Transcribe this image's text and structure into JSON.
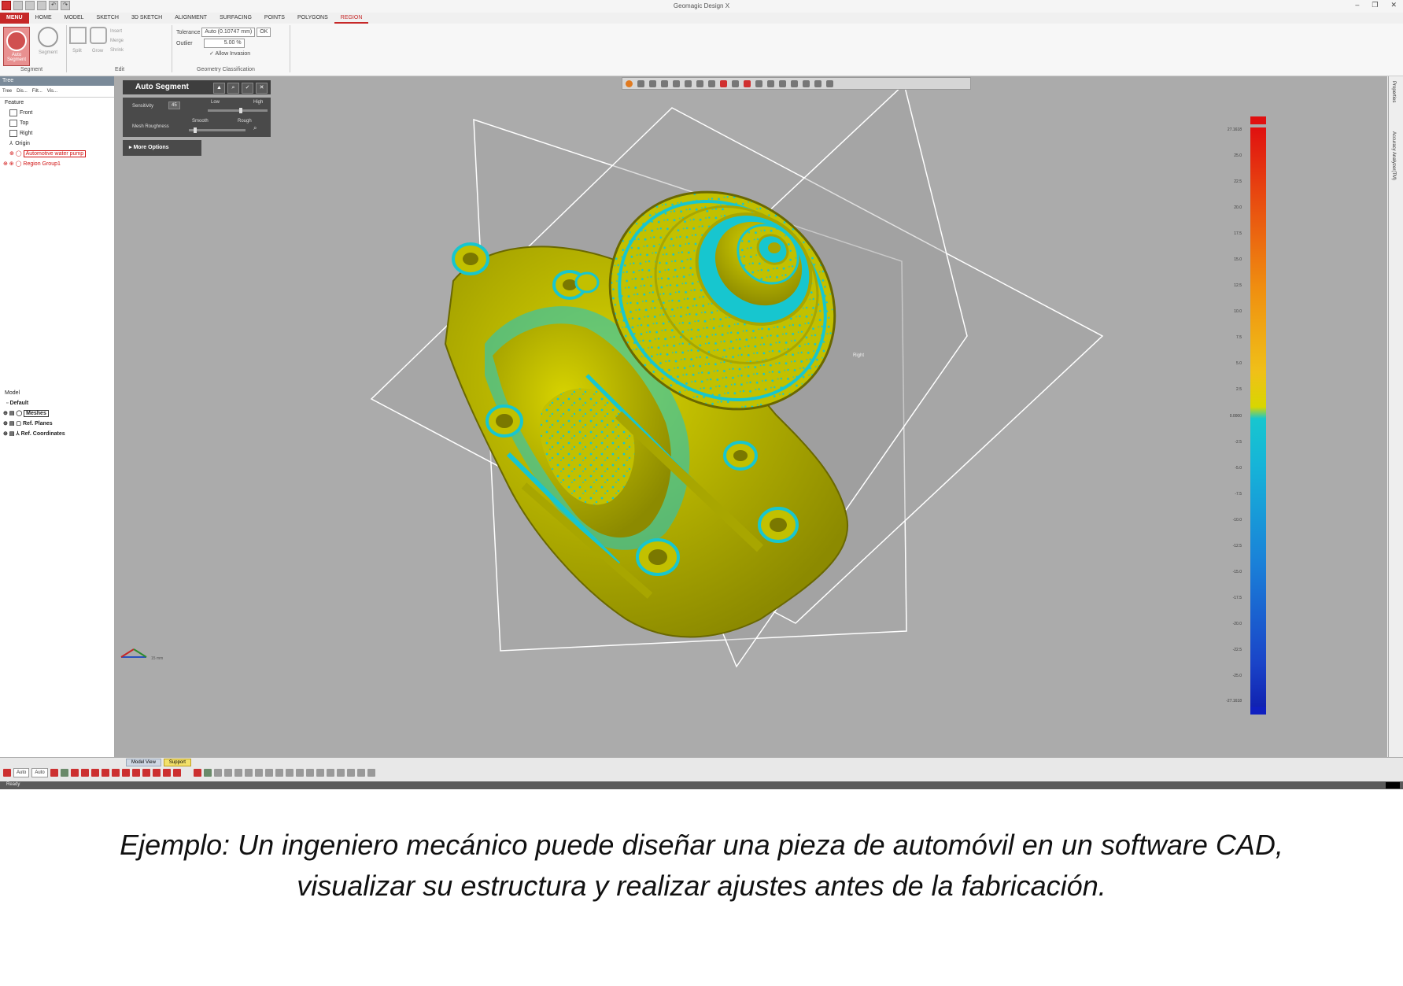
{
  "window": {
    "title": "Geomagic Design X",
    "controls": [
      "–",
      "❐",
      "✕"
    ]
  },
  "ribbon": {
    "tabs": [
      "MENU",
      "HOME",
      "MODEL",
      "SKETCH",
      "3D SKETCH",
      "ALIGNMENT",
      "SURFACING",
      "POINTS",
      "POLYGONS",
      "REGION"
    ],
    "active_tab": "REGION",
    "auto_segment_label": "Auto Segment",
    "segment_items": [
      "Segment",
      "Split",
      "Grow"
    ],
    "edit_items": [
      "Insert",
      "Merge",
      "Shrink"
    ],
    "tolerance_label": "Tolerance",
    "tolerance_value": "Auto (0.10747 mm)",
    "ok_label": "OK",
    "outlier_label": "Outlier",
    "outlier_value": "5.00 %",
    "allow_invasion_label": "Allow Invasion",
    "group_segment": "Segment",
    "group_edit": "Edit",
    "group_geometry": "Geometry Classification"
  },
  "left_panel": {
    "header": "Tree",
    "tools": [
      "Tree",
      "Dis...",
      "Filt...",
      "Vis..."
    ],
    "feature_label": "Feature",
    "feature_items": [
      "Front",
      "Top",
      "Right",
      "Origin",
      "Automotive water pump",
      "Region Group1"
    ],
    "model_label": "Model",
    "model_items": [
      "Default",
      "Meshes",
      "Ref. Planes",
      "Ref. Coordinates"
    ]
  },
  "auto_segment_panel": {
    "title": "Auto Segment",
    "sensitivity_label": "Sensitivity",
    "sensitivity_value": "45",
    "low_label": "Low",
    "high_label": "High",
    "mesh_roughness_label": "Mesh Roughness",
    "smooth_label": "Smooth",
    "rough_label": "Rough",
    "more_options_label": "More Options"
  },
  "color_scale": {
    "top_value": "27.1618",
    "labels": [
      "25.0",
      "22.5",
      "20.0",
      "17.5",
      "15.0",
      "12.5",
      "10.0",
      "7.5",
      "5.0",
      "2.5"
    ],
    "mid_value": "0.0000",
    "neg_labels": [
      "-2.5",
      "-5.0",
      "-7.5",
      "-10.0",
      "-12.5",
      "-15.0",
      "-17.5",
      "-20.0",
      "-22.5",
      "-25.0"
    ],
    "bottom_value": "-27.1618"
  },
  "viewport": {
    "plane_label": "Right",
    "scale_label": "15 mm"
  },
  "side_tabs": [
    "Properties",
    "Accuracy Analyzer(TM)"
  ],
  "bottom": {
    "view_tabs": [
      "Model View",
      "Support"
    ],
    "select_mode_1": "Auto",
    "select_mode_2": "Auto",
    "status": "Ready"
  },
  "caption": {
    "line1": "Ejemplo: Un ingeniero mecánico puede diseñar una pieza de automóvil en un software CAD,",
    "line2": "visualizar su estructura y realizar ajustes antes de la fabricación."
  },
  "colors": {
    "part_yellow": "#c2c000",
    "part_cyan": "#17c6cf",
    "viewport_bg": "#ababab",
    "accent_red": "#c62828"
  }
}
